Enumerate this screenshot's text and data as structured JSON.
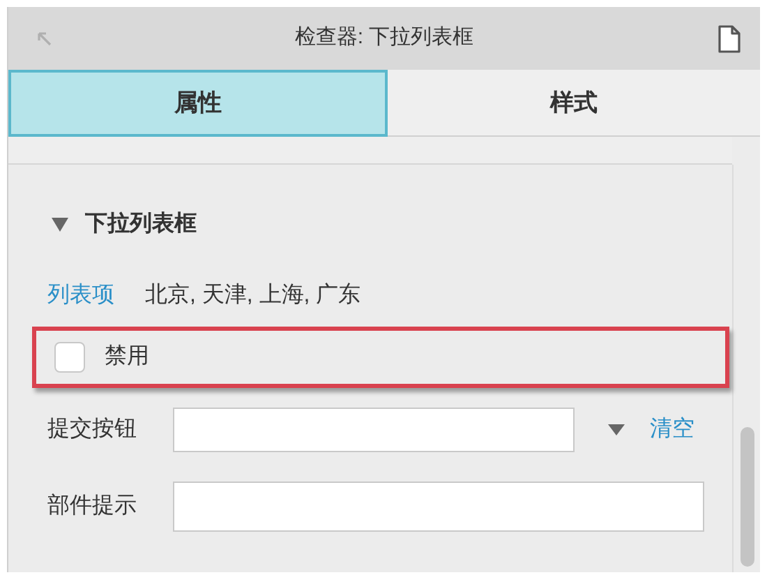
{
  "window": {
    "title": "检查器: 下拉列表框"
  },
  "tabs": [
    {
      "label": "属性",
      "selected": true
    },
    {
      "label": "样式",
      "selected": false
    }
  ],
  "section": {
    "label": "下拉列表框",
    "expanded": true
  },
  "list_items": {
    "label": "列表项",
    "value": "北京, 天津, 上海, 广东"
  },
  "disabled_option": {
    "label": "禁用",
    "checked": false,
    "highlighted": true
  },
  "submit_button": {
    "label": "提交按钮",
    "clear_link": "清空"
  },
  "widget_tip": {
    "label": "部件提示"
  }
}
